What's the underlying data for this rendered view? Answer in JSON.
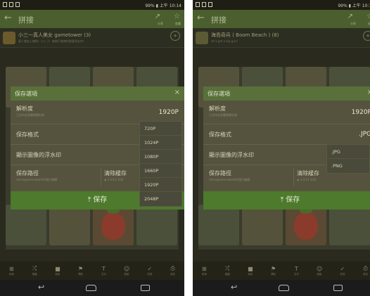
{
  "status_bar": {
    "right_text": "99% ▮ 上午 10:14"
  },
  "app_bar": {
    "back_glyph": "←",
    "title": "拼接",
    "share_glyph": "↗",
    "share_label": "分享",
    "fav_glyph": "☆",
    "fav_label": "收藏"
  },
  "screens": [
    {
      "game": {
        "title": "小三一真人美女 gametower (3)",
        "subtitle": "真人美女上線啦！小三 2：感謝不後悔的熱愛與支持！"
      },
      "dialog": {
        "title": "保存選項",
        "close": "×",
        "resolution_label": "解析度",
        "resolution_sub": "已支持全高畫質解析度",
        "resolution_value": "1920P",
        "format_label": "保存格式",
        "format_value": "",
        "watermark_label": "顯示圖像的浮水印",
        "path_label": "保存路徑",
        "path_sub": "/storage/emulated/0/相片編輯",
        "clear_cache_label": "清除緩存",
        "clear_cache_sub": "◉ 3.2/13.3GB",
        "save_button": "⤒ 保存"
      },
      "dropdown_options": [
        "720P",
        "1024P",
        "1080P",
        "1660P",
        "1920P",
        "2048P"
      ]
    },
    {
      "game": {
        "title": "海島奇兵 ( Boom Beach ) (8)",
        "subtitle": "He's got a big gun!"
      },
      "dialog": {
        "title": "保存選項",
        "close": "×",
        "resolution_label": "解析度",
        "resolution_sub": "已支持全高畫質解析度",
        "resolution_value": "1920P",
        "format_label": "保存格式",
        "format_value": ".JPG",
        "watermark_label": "顯示圖像的浮水印",
        "path_label": "保存路徑",
        "path_sub": "/storage/emulated/0/相片編輯",
        "clear_cache_label": "清除緩存",
        "clear_cache_sub": "◉ 3.2/13.3GB",
        "save_button": "⤒ 保存"
      },
      "dropdown_options": [
        ".JPG",
        ".PNG"
      ]
    }
  ],
  "toolbar": [
    {
      "icon": "grid-icon",
      "glyph": "⊞",
      "label": "布局"
    },
    {
      "icon": "shuffle-icon",
      "glyph": "⤮",
      "label": "換圖"
    },
    {
      "icon": "record-icon",
      "glyph": "■",
      "label": "錄影"
    },
    {
      "icon": "flag-icon",
      "glyph": "⚑",
      "label": "標記"
    },
    {
      "icon": "text-icon",
      "glyph": "T",
      "label": "文字"
    },
    {
      "icon": "sticker-icon",
      "glyph": "☺",
      "label": "貼紙"
    },
    {
      "icon": "check-icon",
      "glyph": "✓",
      "label": "完成"
    },
    {
      "icon": "save-icon",
      "glyph": "⎙",
      "label": "保存"
    }
  ],
  "nav": {
    "back_glyph": "↩"
  }
}
